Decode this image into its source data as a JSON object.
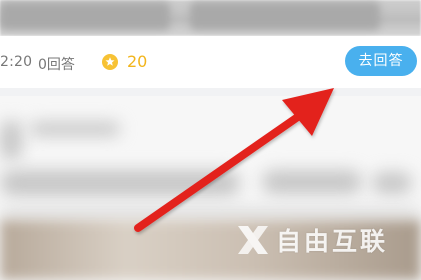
{
  "question_meta": {
    "time": "2:20",
    "answers": "0回答",
    "reward": "20"
  },
  "answer_button": {
    "label": "去回答"
  },
  "watermark": {
    "text": "自由互联"
  },
  "colors": {
    "accent_blue": "#49b0ee",
    "reward_gold": "#f2b51c",
    "arrow_red": "#e3201c"
  },
  "icons": {
    "reward": "star-coin-icon",
    "pointer": "red-arrow-icon",
    "watermark_logo": "x-logo-icon"
  }
}
